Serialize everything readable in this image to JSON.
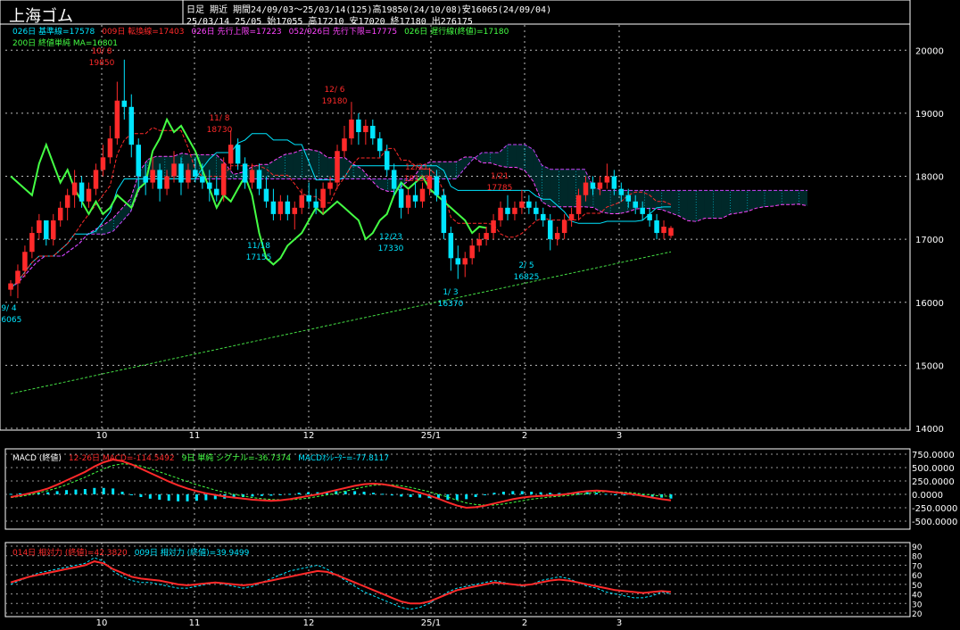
{
  "header": {
    "title": "上海ゴム",
    "line1": "日足 期近  期間24/09/03～25/03/14(125)高19850(24/10/08)安16065(24/09/04)",
    "line2": "25/03/14 25/05 始17055 高17210 安17020 終17180 出276175"
  },
  "legend_main": [
    {
      "text": "026日 基準線=17578",
      "color": "#00e5ff"
    },
    {
      "text": "009日 転換線=17403",
      "color": "#ff2a2a"
    },
    {
      "text": "026日 先行上限=17223",
      "color": "#ff44ff"
    },
    {
      "text": "052/026日 先行下限=17775",
      "color": "#ff44ff"
    },
    {
      "text": "026日 遅行線(終値)=17180",
      "color": "#44ff44"
    },
    {
      "text": "200日 終値単純 MA=16801",
      "color": "#44ff44"
    }
  ],
  "legend_macd": [
    {
      "text": "MACD (終値)",
      "color": "#ffffff"
    },
    {
      "text": "12-26日 MACD=-114.5492",
      "color": "#ff2a2a"
    },
    {
      "text": "9日 単純 シグナル=-36.7374",
      "color": "#44ff44"
    },
    {
      "text": "MACDｵｼﾚｰﾀｰ=-77.8117",
      "color": "#00e5ff"
    }
  ],
  "legend_rsi": [
    {
      "text": "014日 相対力 (終値)=42.3820",
      "color": "#ff2a2a"
    },
    {
      "text": "009日 相対力 (終値)=39.9499",
      "color": "#00e5ff"
    }
  ],
  "x_ticks": [
    "10",
    "11",
    "12",
    "25/1",
    "2",
    "3"
  ],
  "annotations": [
    {
      "date": "9/ 4",
      "value": "16065",
      "color": "#00e5ff"
    },
    {
      "date": "10/ 8",
      "value": "19850",
      "color": "#ff2a2a"
    },
    {
      "date": "11/ 8",
      "value": "18730",
      "color": "#ff2a2a"
    },
    {
      "date": "11/18",
      "value": "17155",
      "color": "#00e5ff"
    },
    {
      "date": "12/ 6",
      "value": "19180",
      "color": "#ff2a2a"
    },
    {
      "date": "12/23",
      "value": "17330",
      "color": "#00e5ff"
    },
    {
      "date": "12/31",
      "value": "18135",
      "color": "#ff2a2a"
    },
    {
      "date": "1/ 3",
      "value": "16370",
      "color": "#00e5ff"
    },
    {
      "date": "1/21",
      "value": "17785",
      "color": "#ff2a2a"
    },
    {
      "date": "2/ 5",
      "value": "16825",
      "color": "#00e5ff"
    }
  ],
  "chart_data": [
    {
      "type": "candlestick",
      "ylim": [
        14000,
        20400
      ],
      "y_ticks": [
        14000,
        15000,
        16000,
        17000,
        18000,
        19000,
        20000
      ],
      "x_tick_labels": [
        "10",
        "11",
        "12",
        "25/1",
        "2",
        "3"
      ],
      "candles": [
        [
          16200,
          16350,
          16100,
          16300
        ],
        [
          16300,
          16600,
          16065,
          16500
        ],
        [
          16500,
          16900,
          16400,
          16800
        ],
        [
          16800,
          17200,
          16700,
          17100
        ],
        [
          17100,
          17400,
          17000,
          17300
        ],
        [
          17300,
          17200,
          16900,
          17000
        ],
        [
          17000,
          17400,
          16900,
          17300
        ],
        [
          17300,
          17600,
          17200,
          17500
        ],
        [
          17500,
          17800,
          17300,
          17700
        ],
        [
          17700,
          18100,
          17500,
          17900
        ],
        [
          17900,
          18000,
          17500,
          17600
        ],
        [
          17600,
          17900,
          17500,
          17800
        ],
        [
          17800,
          18200,
          17700,
          18100
        ],
        [
          18100,
          18500,
          18000,
          18300
        ],
        [
          18300,
          18800,
          18200,
          18600
        ],
        [
          18600,
          19500,
          18500,
          19200
        ],
        [
          19200,
          19850,
          18900,
          19100
        ],
        [
          19100,
          19300,
          18300,
          18500
        ],
        [
          18500,
          18600,
          17800,
          18000
        ],
        [
          18000,
          18200,
          17700,
          17900
        ],
        [
          17900,
          18300,
          17800,
          18100
        ],
        [
          18100,
          18200,
          17600,
          17800
        ],
        [
          17800,
          18100,
          17700,
          18000
        ],
        [
          18000,
          18400,
          17900,
          18200
        ],
        [
          18200,
          18300,
          17700,
          17900
        ],
        [
          17900,
          18200,
          17800,
          18100
        ],
        [
          18100,
          18300,
          17900,
          18000
        ],
        [
          18000,
          18200,
          17800,
          17900
        ],
        [
          17900,
          18100,
          17600,
          17800
        ],
        [
          17800,
          18000,
          17600,
          17700
        ],
        [
          17700,
          18300,
          17600,
          18200
        ],
        [
          18200,
          18730,
          18100,
          18500
        ],
        [
          18500,
          18600,
          18100,
          18200
        ],
        [
          18200,
          18300,
          17800,
          17900
        ],
        [
          17900,
          18200,
          17800,
          18100
        ],
        [
          18100,
          18200,
          17700,
          17800
        ],
        [
          17800,
          18000,
          17500,
          17600
        ],
        [
          17600,
          17800,
          17300,
          17400
        ],
        [
          17400,
          17700,
          17300,
          17600
        ],
        [
          17600,
          17700,
          17300,
          17400
        ],
        [
          17400,
          17600,
          17155,
          17500
        ],
        [
          17500,
          17800,
          17400,
          17700
        ],
        [
          17700,
          17900,
          17500,
          17600
        ],
        [
          17600,
          17800,
          17400,
          17500
        ],
        [
          17500,
          17900,
          17400,
          17800
        ],
        [
          17800,
          18000,
          17700,
          17900
        ],
        [
          17900,
          18500,
          17800,
          18400
        ],
        [
          18400,
          18800,
          18300,
          18600
        ],
        [
          18600,
          19180,
          18500,
          18900
        ],
        [
          18900,
          19000,
          18500,
          18700
        ],
        [
          18700,
          18900,
          18500,
          18800
        ],
        [
          18800,
          18900,
          18500,
          18600
        ],
        [
          18600,
          18700,
          18300,
          18400
        ],
        [
          18400,
          18500,
          18000,
          18100
        ],
        [
          18100,
          18200,
          17700,
          17800
        ],
        [
          17800,
          17900,
          17330,
          17500
        ],
        [
          17500,
          17800,
          17400,
          17700
        ],
        [
          17700,
          17900,
          17500,
          17600
        ],
        [
          17600,
          17900,
          17500,
          17800
        ],
        [
          17800,
          18135,
          17700,
          18000
        ],
        [
          18000,
          18100,
          17600,
          17700
        ],
        [
          17700,
          17800,
          17000,
          17100
        ],
        [
          17100,
          17200,
          16500,
          16700
        ],
        [
          16700,
          16900,
          16370,
          16600
        ],
        [
          16600,
          16800,
          16400,
          16700
        ],
        [
          16700,
          17000,
          16600,
          16900
        ],
        [
          16900,
          17100,
          16800,
          17000
        ],
        [
          17000,
          17200,
          16900,
          17100
        ],
        [
          17100,
          17400,
          17000,
          17300
        ],
        [
          17300,
          17600,
          17200,
          17500
        ],
        [
          17500,
          17700,
          17300,
          17400
        ],
        [
          17400,
          17600,
          17300,
          17500
        ],
        [
          17500,
          17785,
          17400,
          17600
        ],
        [
          17600,
          17700,
          17400,
          17500
        ],
        [
          17500,
          17600,
          17300,
          17400
        ],
        [
          17400,
          17500,
          17200,
          17300
        ],
        [
          17300,
          17400,
          16825,
          17000
        ],
        [
          17000,
          17200,
          16900,
          17100
        ],
        [
          17100,
          17400,
          17000,
          17300
        ],
        [
          17300,
          17500,
          17200,
          17400
        ],
        [
          17400,
          17800,
          17300,
          17700
        ],
        [
          17700,
          18000,
          17600,
          17900
        ],
        [
          17900,
          18000,
          17700,
          17800
        ],
        [
          17800,
          18000,
          17700,
          17900
        ],
        [
          17900,
          18200,
          17800,
          18000
        ],
        [
          18000,
          18100,
          17700,
          17800
        ],
        [
          17800,
          17900,
          17600,
          17700
        ],
        [
          17700,
          17800,
          17500,
          17600
        ],
        [
          17600,
          17700,
          17400,
          17500
        ],
        [
          17500,
          17600,
          17300,
          17400
        ],
        [
          17400,
          17500,
          17200,
          17300
        ],
        [
          17300,
          17400,
          17000,
          17100
        ],
        [
          17100,
          17300,
          17000,
          17200
        ],
        [
          17055,
          17210,
          17020,
          17180
        ]
      ]
    },
    {
      "type": "macd",
      "ylim": [
        -600,
        800
      ],
      "y_ticks": [
        750,
        500,
        250,
        0,
        -250,
        -500
      ],
      "y_tick_labels": [
        "750.0000",
        "500.0000",
        "250.0000",
        "0.0000",
        "-250.0000",
        "-500.0000"
      ],
      "macd": [
        -50,
        -20,
        20,
        60,
        110,
        180,
        260,
        340,
        420,
        520,
        600,
        650,
        620,
        560,
        480,
        400,
        320,
        240,
        170,
        110,
        60,
        20,
        -10,
        -40,
        -60,
        -80,
        -100,
        -110,
        -120,
        -110,
        -90,
        -60,
        -30,
        0,
        40,
        80,
        120,
        160,
        190,
        200,
        190,
        160,
        120,
        80,
        30,
        -20,
        -80,
        -150,
        -210,
        -250,
        -240,
        -210,
        -170,
        -130,
        -90,
        -60,
        -40,
        -30,
        -20,
        -10,
        10,
        40,
        60,
        70,
        60,
        40,
        20,
        0,
        -30,
        -60,
        -90,
        -114
      ],
      "signal": [
        -60,
        -40,
        -10,
        30,
        70,
        120,
        180,
        250,
        320,
        400,
        480,
        540,
        570,
        560,
        530,
        480,
        420,
        360,
        300,
        240,
        180,
        130,
        80,
        40,
        0,
        -30,
        -60,
        -80,
        -95,
        -100,
        -100,
        -90,
        -70,
        -40,
        -10,
        20,
        60,
        100,
        140,
        170,
        180,
        180,
        160,
        130,
        90,
        50,
        0,
        -50,
        -110,
        -160,
        -190,
        -200,
        -200,
        -180,
        -150,
        -120,
        -90,
        -70,
        -50,
        -35,
        -20,
        0,
        20,
        40,
        50,
        50,
        40,
        25,
        5,
        -15,
        -30,
        -37
      ],
      "oscillator": [
        10,
        20,
        30,
        30,
        40,
        60,
        80,
        90,
        100,
        120,
        120,
        110,
        50,
        0,
        -50,
        -80,
        -100,
        -120,
        -130,
        -130,
        -120,
        -110,
        -90,
        -80,
        -60,
        -50,
        -40,
        -30,
        -25,
        -10,
        10,
        30,
        40,
        40,
        50,
        60,
        60,
        60,
        50,
        30,
        10,
        -20,
        -40,
        -50,
        -60,
        -70,
        -80,
        -100,
        -100,
        -90,
        -50,
        -10,
        30,
        50,
        60,
        60,
        50,
        40,
        30,
        25,
        30,
        40,
        40,
        30,
        10,
        -10,
        -20,
        -25,
        -35,
        -45,
        -60,
        -78
      ]
    },
    {
      "type": "rsi",
      "ylim": [
        20,
        90
      ],
      "y_ticks": [
        90,
        80,
        70,
        60,
        50,
        40,
        30,
        20
      ],
      "rsi14": [
        52,
        55,
        58,
        60,
        62,
        64,
        66,
        68,
        70,
        74,
        72,
        66,
        62,
        58,
        56,
        55,
        54,
        52,
        50,
        49,
        50,
        51,
        52,
        51,
        50,
        49,
        50,
        52,
        54,
        56,
        58,
        60,
        62,
        64,
        63,
        60,
        56,
        52,
        48,
        44,
        40,
        36,
        32,
        30,
        30,
        32,
        36,
        40,
        44,
        46,
        48,
        50,
        52,
        51,
        50,
        49,
        50,
        52,
        54,
        55,
        54,
        52,
        50,
        48,
        46,
        44,
        43,
        42,
        41,
        42,
        43,
        42
      ],
      "rsi9": [
        50,
        54,
        58,
        62,
        64,
        66,
        68,
        70,
        72,
        78,
        74,
        64,
        58,
        54,
        52,
        52,
        50,
        48,
        46,
        46,
        48,
        50,
        52,
        50,
        48,
        46,
        48,
        52,
        56,
        60,
        64,
        66,
        68,
        70,
        66,
        60,
        54,
        48,
        42,
        38,
        34,
        30,
        26,
        24,
        26,
        30,
        36,
        42,
        46,
        48,
        50,
        52,
        54,
        52,
        50,
        48,
        50,
        54,
        56,
        58,
        56,
        52,
        48,
        46,
        42,
        40,
        38,
        36,
        36,
        38,
        42,
        40
      ]
    }
  ]
}
